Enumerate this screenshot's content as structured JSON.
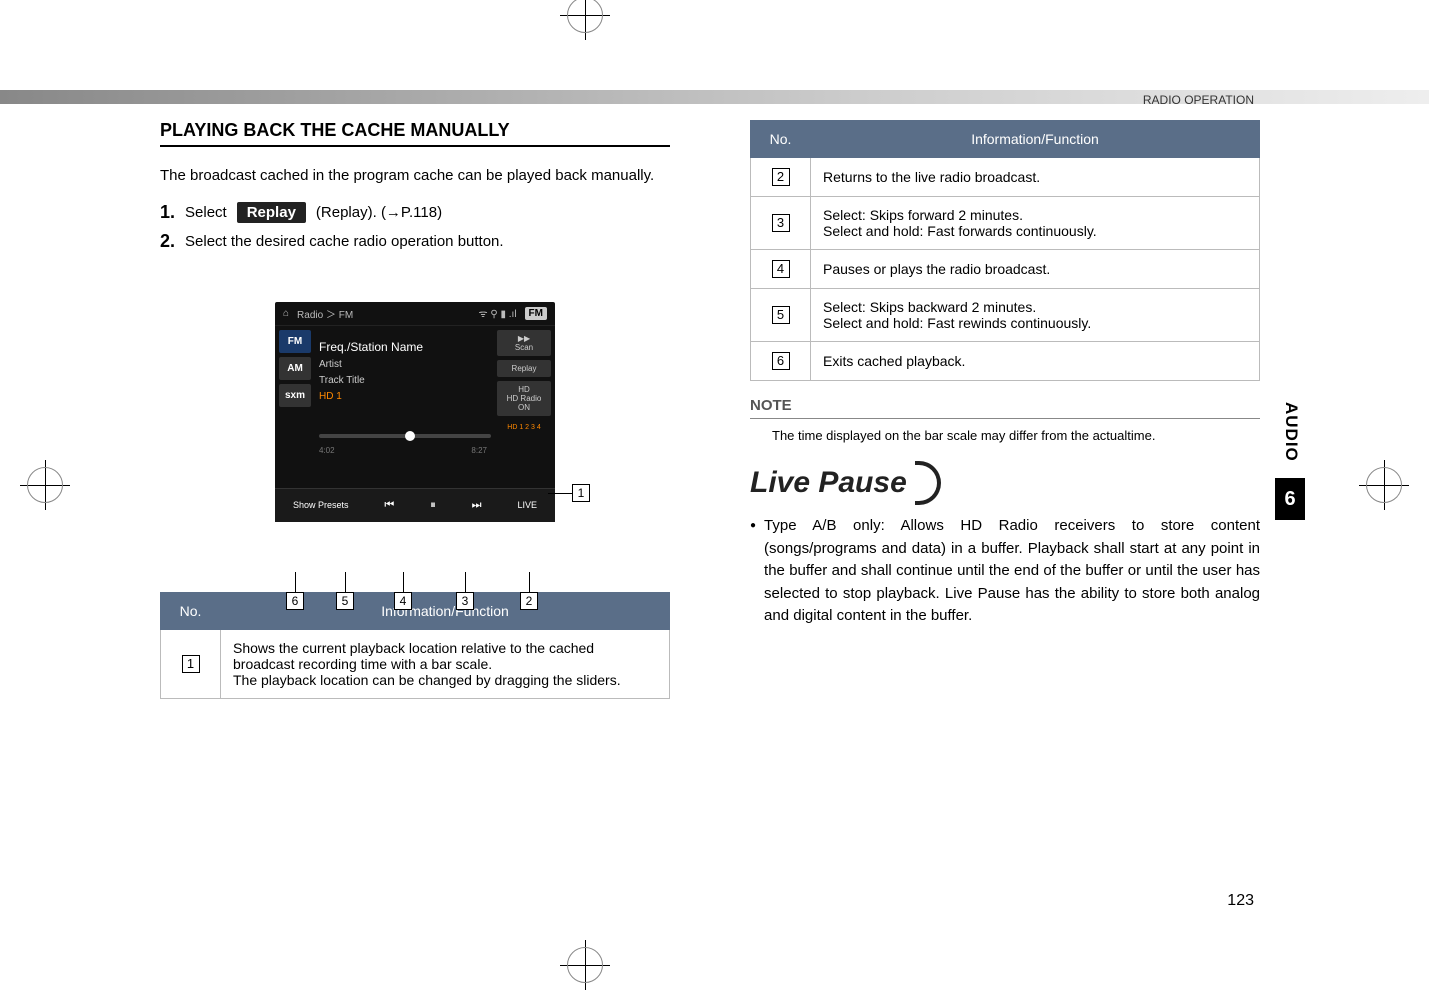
{
  "header": {
    "section": "RADIO OPERATION"
  },
  "sideTab": {
    "label": "AUDIO",
    "chapter": "6"
  },
  "pageNumber": "123",
  "left": {
    "title": "PLAYING BACK THE CACHE MANUALLY",
    "intro": "The broadcast cached in the program cache can be played back manually.",
    "step1_prefix": "Select",
    "step1_btn": "Replay",
    "step1_suffix": "(Replay). (→P.118)",
    "step2": "Select the desired cache radio operation button.",
    "screenshot": {
      "breadcrumb": "Radio  ＞  FM",
      "topRight": "FM",
      "bands": [
        "FM",
        "AM",
        "sxm"
      ],
      "station": "Freq./Station Name",
      "artist": "Artist",
      "track": "Track Title",
      "hd": "HD 1",
      "rightBtns": {
        "scan": "Scan",
        "replay": "Replay",
        "hdradio": "HD Radio ON"
      },
      "timeStart": "4:02",
      "timeEnd": "8:27",
      "hdList": "HD 1 2 3 4",
      "controls": {
        "showPresets": "Show Presets",
        "prev": "⏮",
        "pause": "⏸",
        "next": "⏭",
        "live": "LIVE"
      }
    },
    "table": {
      "headerNo": "No.",
      "headerInfo": "Information/Function",
      "row1": "Shows the current playback location relative to the cached broadcast recording time with a bar scale.\nThe playback location can be changed by dragging the sliders."
    }
  },
  "right": {
    "table": {
      "headerNo": "No.",
      "headerInfo": "Information/Function",
      "row2": "Returns to the live radio broadcast.",
      "row3a": "Select: Skips forward 2 minutes.",
      "row3b": "Select and hold: Fast forwards continuously.",
      "row4": "Pauses or plays the radio broadcast.",
      "row5a": "Select: Skips backward 2 minutes.",
      "row5b": "Select and hold: Fast rewinds continuously.",
      "row6": "Exits cached playback."
    },
    "noteTitle": "NOTE",
    "noteText": "The time displayed on the bar scale may differ from the actualtime.",
    "livePause": "Live Pause",
    "bullet": "Type A/B only: Allows HD Radio receivers to store content (songs/programs and data) in a buffer. Playback shall start at any point in the buffer and shall continue until the end of the buffer or until the user has selected to stop playback. Live Pause has the ability to store both analog and digital content in the buffer."
  },
  "callouts": {
    "c1": "1",
    "c2": "2",
    "c3": "3",
    "c4": "4",
    "c5": "5",
    "c6": "6"
  }
}
